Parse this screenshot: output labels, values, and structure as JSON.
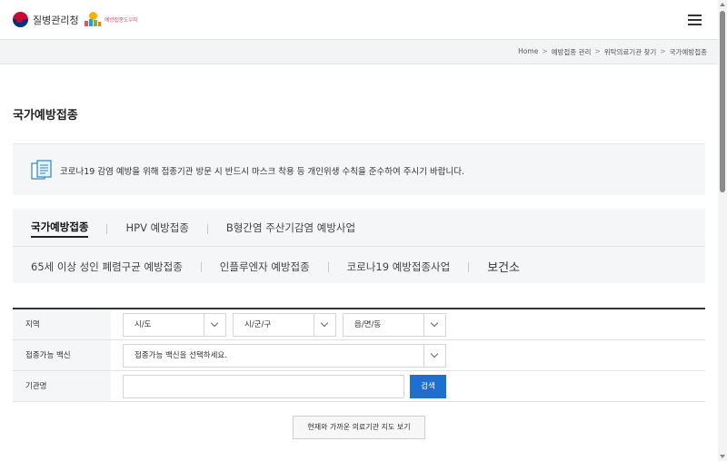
{
  "header": {
    "logo1_text": "질병관리청",
    "logo2_text": "예방접종도우미"
  },
  "breadcrumb": [
    "Home",
    "예방접종 관리",
    "위탁의료기관 찾기",
    "국가예방접종"
  ],
  "breadcrumb_separator": ">",
  "page_title": "국가예방접종",
  "notice": "코로나19 감염 예방을 위해 접종기관 방문 시 반드시 마스크 착용 등 개인위생 수칙을 준수하여 주시기 바랍니다.",
  "tabs": {
    "row1": [
      "국가예방접종",
      "HPV 예방접종",
      "B형간염 주산기감염 예방사업"
    ],
    "row2": [
      "65세 이상 성인 폐렴구균 예방접종",
      "인플루엔자 예방접종",
      "코로나19 예방접종사업",
      "보건소"
    ]
  },
  "form": {
    "region_label": "지역",
    "sido": "시/도",
    "sigungu": "시/군/구",
    "eupmyeondong": "읍/면/동",
    "vaccine_label": "접종가능 백신",
    "vaccine_select": "접종가능 백신을 선택하세요.",
    "org_label": "기관명",
    "org_value": "",
    "search_button": "검색"
  },
  "map_button": "현재와 가까운 의료기관 지도 보기",
  "colors": {
    "accent": "#1f6fd1",
    "panel_bg": "#f4f6f8"
  }
}
